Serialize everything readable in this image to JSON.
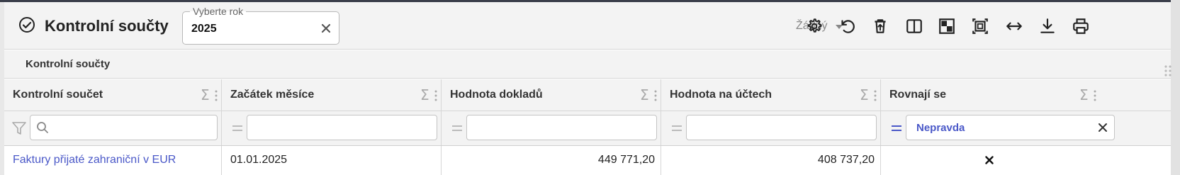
{
  "toolbar": {
    "title": "Kontrolní součty",
    "year_field": {
      "label": "Vyberte rok",
      "value": "2025"
    },
    "layout_select": {
      "value": "Žádný"
    },
    "buttons": [
      {
        "name": "settings-button",
        "icon": "gear-icon"
      },
      {
        "name": "reset-button",
        "icon": "undo-icon"
      },
      {
        "name": "delete-button",
        "icon": "trash-upload-icon"
      },
      {
        "name": "split-view-button",
        "icon": "columns-icon"
      },
      {
        "name": "select-view-button",
        "icon": "checkerboard-icon"
      },
      {
        "name": "fit-screen-button",
        "icon": "fit-frame-icon"
      },
      {
        "name": "auto-width-button",
        "icon": "arrows-horizontal-icon"
      },
      {
        "name": "download-button",
        "icon": "download-icon"
      },
      {
        "name": "print-button",
        "icon": "printer-icon"
      }
    ]
  },
  "section": {
    "title": "Kontrolní součty"
  },
  "table": {
    "columns": [
      {
        "label": "Kontrolní součet"
      },
      {
        "label": "Začátek měsíce"
      },
      {
        "label": "Hodnota dokladů"
      },
      {
        "label": "Hodnota na účtech"
      },
      {
        "label": "Rovnají se"
      }
    ],
    "filters": [
      {
        "value": ""
      },
      {
        "value": ""
      },
      {
        "value": ""
      },
      {
        "value": ""
      },
      {
        "value": "Nepravda"
      }
    ],
    "rows": [
      {
        "kontrolni_soucet": "Faktury přijaté zahraniční v EUR",
        "zacatek_mesice": "01.01.2025",
        "hodnota_dokladu": "449 771,20",
        "hodnota_na_uctech": "408 737,20",
        "rovnaji_se": false
      }
    ]
  },
  "colors": {
    "accent": "#4a58c8",
    "toolbar_bg": "#f3f3f3",
    "border": "#d6d6d6"
  }
}
